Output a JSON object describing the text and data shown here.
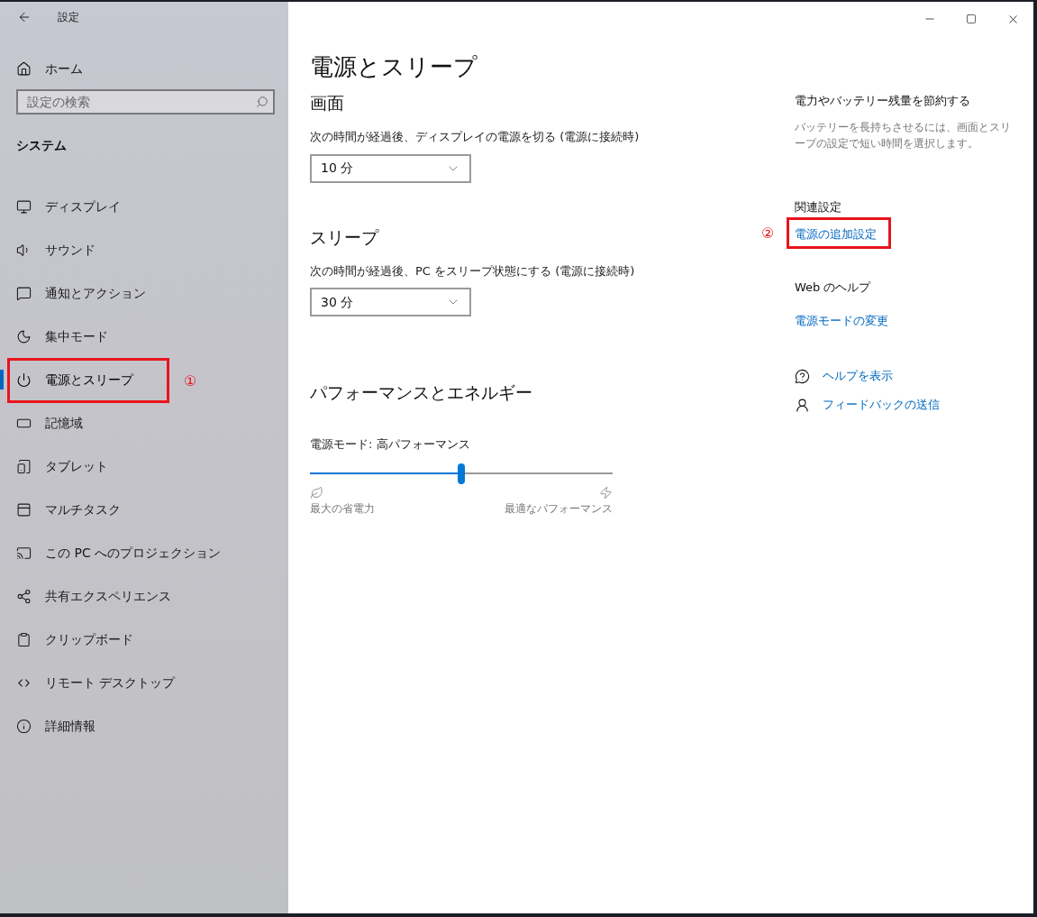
{
  "window": {
    "title": "設定"
  },
  "sidebar": {
    "home": "ホーム",
    "search": {
      "placeholder": "設定の検索"
    },
    "section": "システム",
    "items": [
      {
        "kind": "display",
        "label": "ディスプレイ",
        "selected": false
      },
      {
        "kind": "sound",
        "label": "サウンド",
        "selected": false
      },
      {
        "kind": "notifications",
        "label": "通知とアクション",
        "selected": false
      },
      {
        "kind": "focus",
        "label": "集中モード",
        "selected": false
      },
      {
        "kind": "power",
        "label": "電源とスリープ",
        "selected": true,
        "annotation": "①"
      },
      {
        "kind": "storage",
        "label": "記憶域",
        "selected": false
      },
      {
        "kind": "tablet",
        "label": "タブレット",
        "selected": false
      },
      {
        "kind": "multitask",
        "label": "マルチタスク",
        "selected": false
      },
      {
        "kind": "projection",
        "label": "この PC へのプロジェクション",
        "selected": false
      },
      {
        "kind": "shared",
        "label": "共有エクスペリエンス",
        "selected": false
      },
      {
        "kind": "clipboard",
        "label": "クリップボード",
        "selected": false
      },
      {
        "kind": "remote",
        "label": "リモート デスクトップ",
        "selected": false
      },
      {
        "kind": "info",
        "label": "詳細情報",
        "selected": false
      }
    ]
  },
  "main": {
    "title": "電源とスリープ",
    "sections": [
      {
        "heading": "画面",
        "label": "次の時間が経過後、ディスプレイの電源を切る (電源に接続時)",
        "value": "10 分"
      },
      {
        "heading": "スリープ",
        "label": "次の時間が経過後、PC をスリープ状態にする (電源に接続時)",
        "value": "30 分"
      }
    ],
    "performance": {
      "heading": "パフォーマンスとエネルギー",
      "label": "電源モード: 高パフォーマンス",
      "level": 0.5,
      "min_label": "最大の省電力",
      "max_label": "最適なパフォーマンス"
    }
  },
  "aside": {
    "save": {
      "heading": "電力やバッテリー残量を節約する",
      "text": "バッテリーを長持ちさせるには、画面とスリープの設定で短い時間を選択します。"
    },
    "related": {
      "heading": "関連設定",
      "links": [
        {
          "label": "電源の追加設定",
          "annotation": "②"
        }
      ]
    },
    "web_help": {
      "heading": "Web のヘルプ",
      "links": [
        {
          "label": "電源モードの変更"
        }
      ]
    },
    "actions": [
      {
        "kind": "help",
        "label": "ヘルプを表示"
      },
      {
        "kind": "feedback",
        "label": "フィードバックの送信"
      }
    ]
  }
}
